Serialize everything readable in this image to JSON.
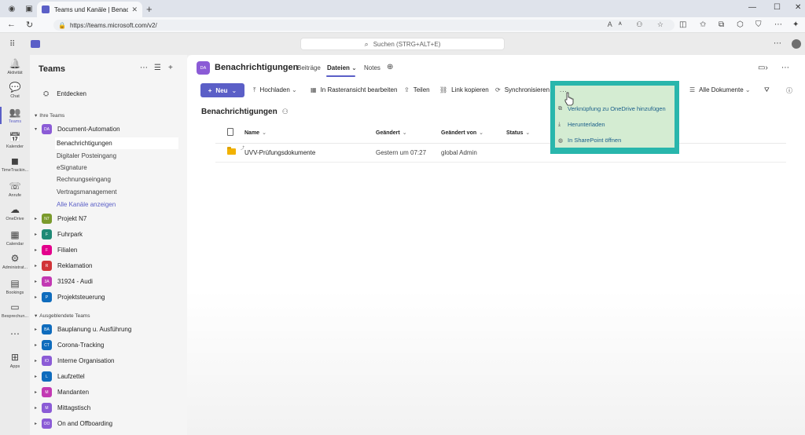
{
  "browser": {
    "tab_title": "Teams und Kanäle | Benachrichtigu",
    "url": "https://teams.microsoft.com/v2/"
  },
  "teams": {
    "search_placeholder": "Suchen (STRG+ALT+E)"
  },
  "rail": [
    {
      "label": "Aktivität",
      "icon": "bell-icon"
    },
    {
      "label": "Chat",
      "icon": "chat-icon"
    },
    {
      "label": "Teams",
      "icon": "teams-icon",
      "active": true
    },
    {
      "label": "Kalender",
      "icon": "calendar-icon"
    },
    {
      "label": "TimeTrackin...",
      "icon": "timetracking-icon"
    },
    {
      "label": "Anrufe",
      "icon": "phone-icon"
    },
    {
      "label": "OneDrive",
      "icon": "cloud-icon"
    },
    {
      "label": "Calendar",
      "icon": "calendar-grid-icon"
    },
    {
      "label": "Administrat...",
      "icon": "admin-icon"
    },
    {
      "label": "Bookings",
      "icon": "bookings-icon"
    },
    {
      "label": "Besprechun...",
      "icon": "video-icon"
    },
    {
      "label": "...",
      "icon": "more-icon"
    },
    {
      "label": "Apps",
      "icon": "apps-icon"
    }
  ],
  "panel": {
    "title": "Teams",
    "discover": "Entdecken",
    "section_own": "Ihre Teams",
    "section_hidden": "Ausgeblendete Teams",
    "expanded_team": {
      "name": "Document-Automation",
      "abbr": "DA",
      "color": "#8b5bd6"
    },
    "channels": [
      {
        "name": "Benachrichtigungen",
        "active": true
      },
      {
        "name": "Digitaler Posteingang"
      },
      {
        "name": "eSignature"
      },
      {
        "name": "Rechnungseingang"
      },
      {
        "name": "Vertragsmanagement"
      }
    ],
    "show_all": "Alle Kanäle anzeigen",
    "own_teams": [
      {
        "name": "Projekt N7",
        "abbr": "N7",
        "color": "#7a9a2c"
      },
      {
        "name": "Fuhrpark",
        "abbr": "F",
        "color": "#1f8a76"
      },
      {
        "name": "Filialen",
        "abbr": "F",
        "color": "#e3008c"
      },
      {
        "name": "Reklamation",
        "abbr": "R",
        "color": "#d13438"
      },
      {
        "name": "31924 - Audi",
        "abbr": "3A",
        "color": "#c239b3"
      },
      {
        "name": "Projektsteuerung",
        "abbr": "P",
        "color": "#0f6cbd"
      }
    ],
    "hidden_teams": [
      {
        "name": "Bauplanung u. Ausführung",
        "abbr": "BA",
        "color": "#0f6cbd"
      },
      {
        "name": "Corona-Tracking",
        "abbr": "CT",
        "color": "#0f6cbd"
      },
      {
        "name": "Interne Organisation",
        "abbr": "IO",
        "color": "#8b5bd6"
      },
      {
        "name": "Laufzettel",
        "abbr": "L",
        "color": "#0f6cbd"
      },
      {
        "name": "Mandanten",
        "abbr": "M",
        "color": "#c239b3"
      },
      {
        "name": "Mittagstisch",
        "abbr": "M",
        "color": "#8b5bd6"
      },
      {
        "name": "On and Offboarding",
        "abbr": "OO",
        "color": "#8b5bd6"
      }
    ]
  },
  "channel": {
    "abbr": "DA",
    "title": "Benachrichtigungen",
    "tabs": [
      "Beiträge",
      "Dateien",
      "Notes"
    ],
    "active_tab": "Dateien"
  },
  "toolbar": {
    "new": "Neu",
    "upload": "Hochladen",
    "grid_edit": "In Rasteransicht bearbeiten",
    "share": "Teilen",
    "copy_link": "Link kopieren",
    "sync": "Synchronisieren",
    "all_docs": "Alle Dokumente"
  },
  "library": {
    "title": "Benachrichtigungen",
    "columns": [
      "Name",
      "Geändert",
      "Geändert von",
      "Status"
    ],
    "rows": [
      {
        "name": "UVV-Prüfungsdokumente",
        "modified": "Gestern um 07:27",
        "modified_by": "global Admin",
        "status": ""
      }
    ]
  },
  "context_menu": {
    "dots": "...",
    "items": [
      {
        "label": "Verknüpfung zu OneDrive hinzufügen",
        "icon": "shortcut-icon"
      },
      {
        "label": "Herunterladen",
        "icon": "download-icon"
      },
      {
        "label": "In SharePoint öffnen",
        "icon": "sharepoint-icon"
      }
    ]
  },
  "colors": {
    "accent": "#5b5fc7",
    "highlight_frame": "#29b6ac",
    "highlight_fill": "#d4ecd2"
  }
}
